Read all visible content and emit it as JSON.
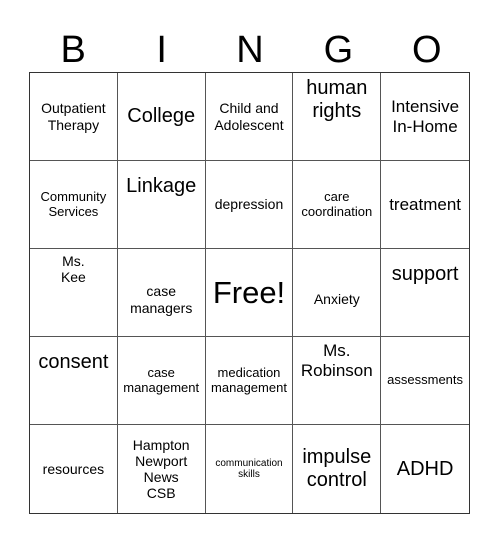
{
  "header": {
    "letters": [
      "B",
      "I",
      "N",
      "G",
      "O"
    ]
  },
  "cells": [
    {
      "text": "Outpatient\nTherapy",
      "size": "md"
    },
    {
      "text": "College",
      "size": "xl"
    },
    {
      "text": "Child and\nAdolescent",
      "size": "md"
    },
    {
      "text": "human\nrights",
      "size": "xl"
    },
    {
      "text": "Intensive\nIn-Home",
      "size": "lg"
    },
    {
      "text": "Community\nServices",
      "size": "sm"
    },
    {
      "text": "Linkage",
      "size": "xl"
    },
    {
      "text": "depression",
      "size": "md"
    },
    {
      "text": "care\ncoordination",
      "size": "sm"
    },
    {
      "text": "treatment",
      "size": "lg"
    },
    {
      "text": "Ms.\nKee",
      "size": "md"
    },
    {
      "text": "case\nmanagers",
      "size": "md"
    },
    {
      "text": "Free!",
      "size": "free"
    },
    {
      "text": "Anxiety",
      "size": "md"
    },
    {
      "text": "support",
      "size": "xl"
    },
    {
      "text": "consent",
      "size": "xl"
    },
    {
      "text": "case\nmanagement",
      "size": "sm"
    },
    {
      "text": "medication\nmanagement",
      "size": "sm"
    },
    {
      "text": "Ms.\nRobinson",
      "size": "lg"
    },
    {
      "text": "assessments",
      "size": "sm"
    },
    {
      "text": "resources",
      "size": "md"
    },
    {
      "text": "Hampton\nNewport\nNews\nCSB",
      "size": "md"
    },
    {
      "text": "communication\nskills",
      "size": "xs"
    },
    {
      "text": "impulse\ncontrol",
      "size": "xl"
    },
    {
      "text": "ADHD",
      "size": "xl"
    }
  ]
}
